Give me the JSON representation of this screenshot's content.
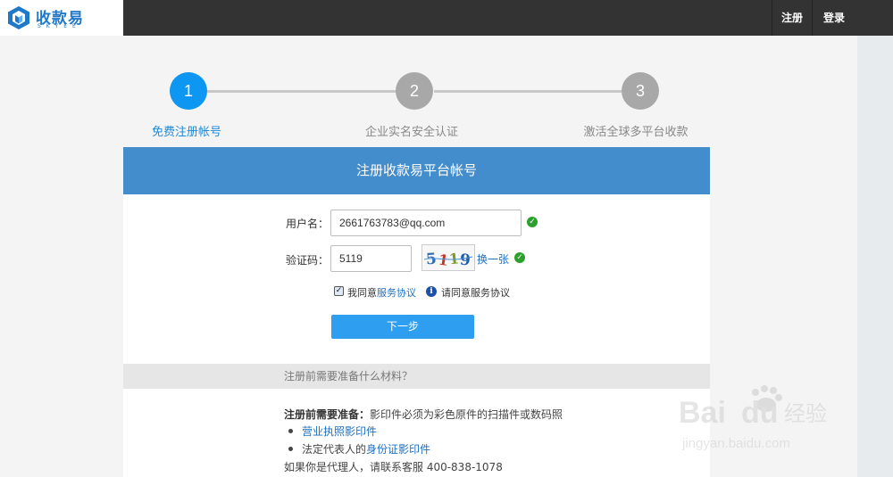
{
  "brand": {
    "name": "收款易",
    "subtitle": "SKYEE",
    "accent_color": "#1f78c8"
  },
  "nav": {
    "register": "注册",
    "login": "登录"
  },
  "steps": [
    {
      "number": "1",
      "label": "免费注册帐号",
      "state": "active"
    },
    {
      "number": "2",
      "label": "企业实名安全认证",
      "state": "inactive"
    },
    {
      "number": "3",
      "label": "激活全球多平台收款",
      "state": "inactive"
    }
  ],
  "form": {
    "header": "注册收款易平台帐号",
    "username_label": "用户名：",
    "username_value": "2661763783@qq.com",
    "captcha_label": "验证码：",
    "captcha_value": "5119",
    "captcha_image_text": "5119",
    "refresh_captcha": "换一张",
    "agree_prefix": "我同意",
    "agree_link": "服务协议",
    "agree_hint": "请同意服务协议",
    "agree_checked": true,
    "next_button": "下一步"
  },
  "prep": {
    "section_title": "注册前需要准备什么材料？",
    "intro_bold": "注册前需要准备：",
    "intro_text": "影印件必须为彩色原件的扫描件或数码照",
    "item1_link": "营业执照影印件",
    "item2_prefix": "法定代表人的",
    "item2_link": "身份证影印件",
    "agent_text": "如果你是代理人，请联系客服 400-838-1078"
  },
  "watermark": {
    "text": "Bai",
    "text2": "du",
    "cn": "经验",
    "url": "jingyan.baidu.com"
  },
  "colors": {
    "primary_blue": "#448dcd",
    "button_blue": "#2d9ef0",
    "active_step": "#0d96f2",
    "inactive_step": "#a8a8a8",
    "success_green": "#2ca02c"
  }
}
